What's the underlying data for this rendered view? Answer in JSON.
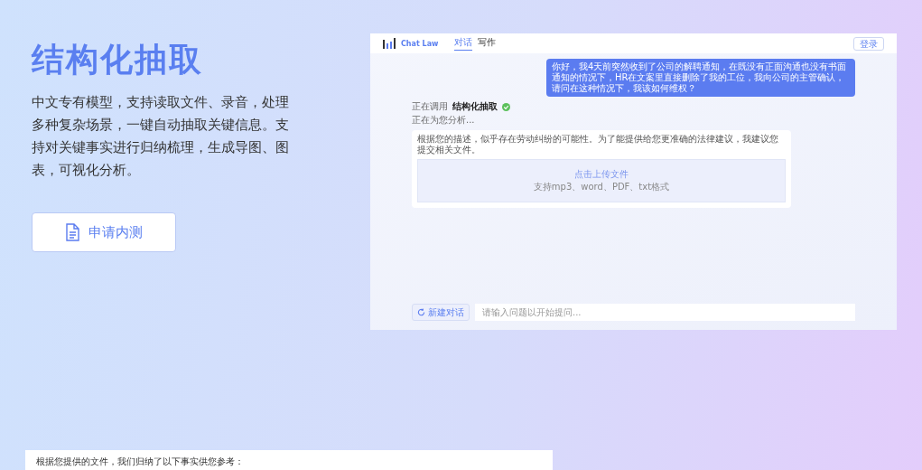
{
  "hero": {
    "title": "结构化抽取",
    "description": "中文专有模型，支持读取文件、录音，处理多种复杂场景，一键自动抽取关键信息。支持对关键事实进行归纳梳理，生成导图、图表，可视化分析。",
    "button": "申请内测"
  },
  "app": {
    "brand": "Chat Law",
    "tabs": [
      {
        "label": "对话",
        "selected": true
      },
      {
        "label": "写作",
        "selected": false
      }
    ],
    "login": "登录",
    "user_message": "你好，我4天前突然收到了公司的解聘通知，在既没有正面沟通也没有书面通知的情况下，HR在文案里直接删除了我的工位，我向公司的主管确认，请问在这种情况下，我该如何维权？",
    "tool_status": {
      "prefix": "正在调用",
      "tool": "结构化抽取",
      "done": true
    },
    "analyzing": "正在为您分析...",
    "reply": "根据您的描述，似乎存在劳动纠纷的可能性。为了能提供给您更准确的法律建议，我建议您提交相关文件。",
    "upload": {
      "action": "点击上传文件",
      "formats": "支持mp3、word、PDF、txt格式"
    },
    "new_chat": "新建对话",
    "input_placeholder": "请输入问题以开始提问..."
  },
  "next_preview": {
    "text": "根据您提供的文件，我们归纳了以下事实供您参考："
  }
}
